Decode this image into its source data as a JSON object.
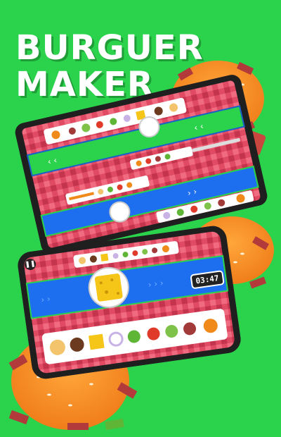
{
  "title": {
    "line1": "BURGUER",
    "line2": "MAKER"
  },
  "phone": {
    "timer": "03:47",
    "pause_icon": "pause-icon"
  },
  "colors": {
    "background": "#2bd24c",
    "lane_green": "#2bd24c",
    "lane_blue": "#1e6ff0",
    "checker": "#d8415a"
  }
}
